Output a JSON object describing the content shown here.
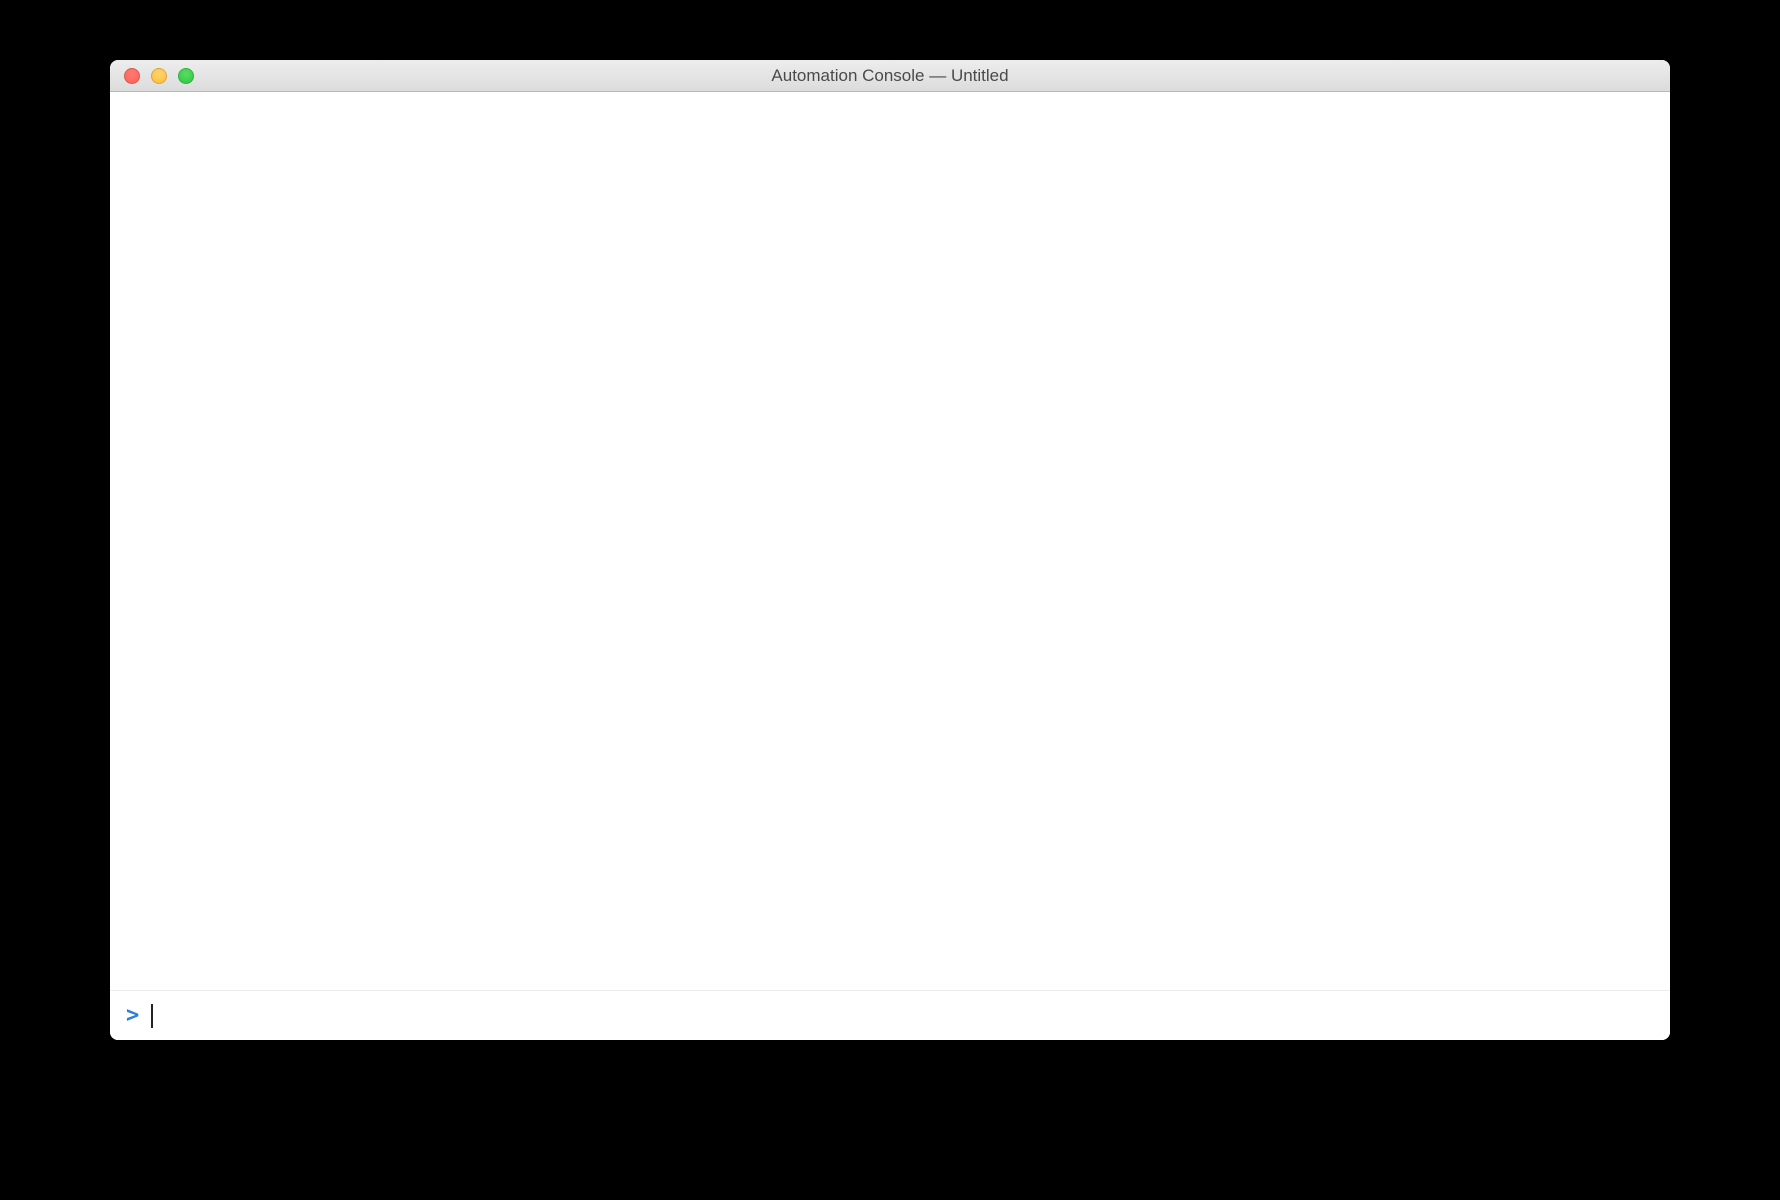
{
  "window": {
    "title": "Automation Console — Untitled"
  },
  "console": {
    "prompt": ">",
    "input_value": "",
    "input_placeholder": ""
  },
  "traffic_lights": {
    "close": "close",
    "minimize": "minimize",
    "zoom": "zoom"
  }
}
